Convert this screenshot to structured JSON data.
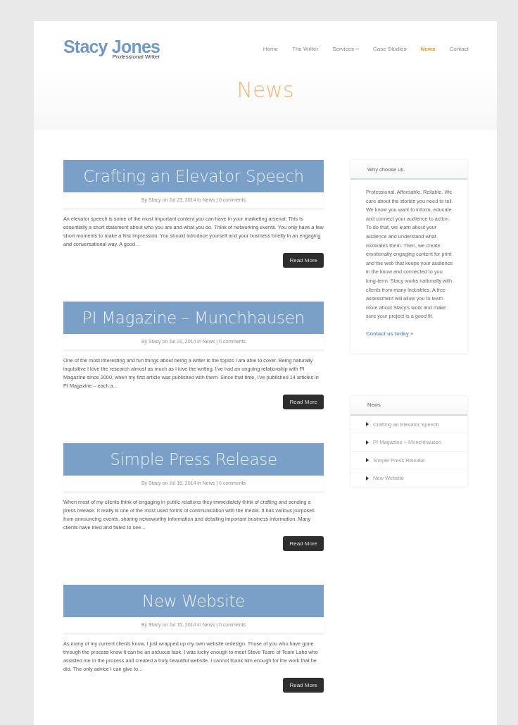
{
  "logo": {
    "name": "Stacy Jones",
    "tagline": "Professional Writer"
  },
  "nav": [
    {
      "label": "Home",
      "selected": false,
      "dropdown": false
    },
    {
      "label": "The Writer",
      "selected": false,
      "dropdown": false
    },
    {
      "label": "Services",
      "selected": false,
      "dropdown": true
    },
    {
      "label": "Case Studies",
      "selected": false,
      "dropdown": false
    },
    {
      "label": "News",
      "selected": true,
      "dropdown": false
    },
    {
      "label": "Contact",
      "selected": false,
      "dropdown": false
    }
  ],
  "page_title": "News",
  "posts": [
    {
      "title": "Crafting an Elevator Speech",
      "meta": "By Stacy on Jul 23, 2014 in News | 0 comments",
      "excerpt": "An elevator speech is some of the most important content you can have in your marketing arsenal. This is essentially a short statement about who you are and what you do. Think of networking events. You only have a few short moments to make a first impression. You should introduce yourself and your business briefly in an engaging and conversational way. A good...",
      "button": "Read More"
    },
    {
      "title": "PI Magazine – Munchhausen",
      "meta": "By Stacy on Jul 21, 2014 in News | 0 comments",
      "excerpt": "One of the most interesting and fun things about being a writer is the topics I am able to cover. Being naturally inquisitive I love the research almost as much as I love the writing. I've had an ongoing relationship with PI Magazine since 2000, when my first article was published with them. Since that time, I've published 14 articles in PI Magazine – each a...",
      "button": "Read More"
    },
    {
      "title": "Simple Press Release",
      "meta": "By Stacy on Jul 16, 2014 in News | 0 comments",
      "excerpt": "When most of my clients think of engaging in public relations they immediately think of crafting and sending a press release. It really is one of the most used forms of communication with the media. It has various purposes from announcing events, sharing newsworthy information and detailing important business information. Many clients have tried and failed to see...",
      "button": "Read More"
    },
    {
      "title": "New Website",
      "meta": "By Stacy on Jul 15, 2014 in News | 0 comments",
      "excerpt": "As many of my current clients know, I just wrapped up my own website redesign. Those of you who have gone through the process know it can be an arduous task. I was lucky enough to meet Steve Teare of Team Labs who assisted me in the process and created a truly beautiful website. I cannot thank him enough for the work that he did. The only advice I can give to...",
      "button": "Read More"
    }
  ],
  "sidebar": [
    {
      "kind": "text",
      "title": "Why choose us.",
      "body": "Professional. Affordable. Reliable. We care about the stories you need to tell. We know you want to inform, educate and connect your audience to action. To do that, we learn about your audience and understand what motivates them. Then, we create emotionally engaging content for print and the web that keeps your audience in the know and connected to you long-term. Stacy works nationally with clients from many industries. A free assessment will allow you to learn more about Stacy's work and make sure your project is a good fit.",
      "link": "Contact us today »"
    },
    {
      "kind": "list",
      "title": "News",
      "items": [
        "Crafting an Elevator Speech",
        "PI Magazine – Munchhausen",
        "Simple Press Release",
        "New Website"
      ]
    }
  ]
}
